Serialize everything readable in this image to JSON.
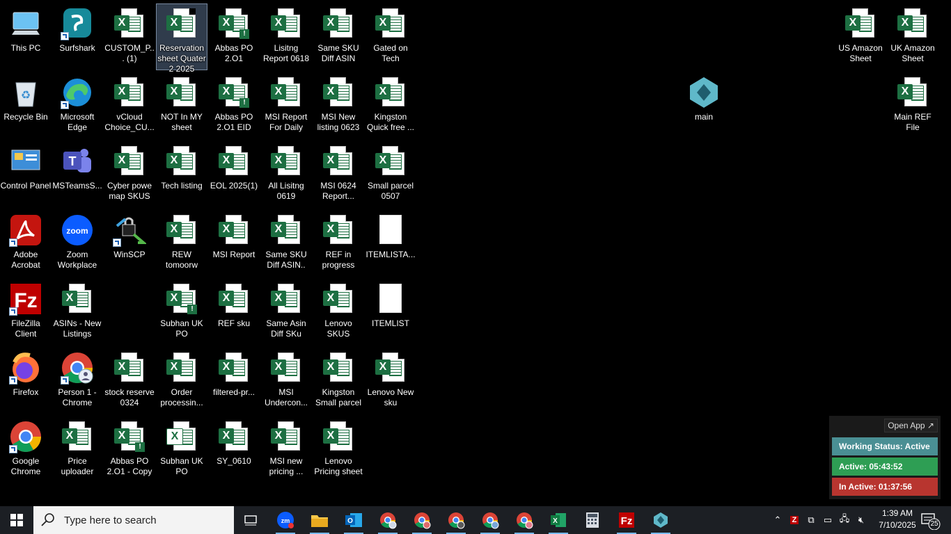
{
  "desktop": {
    "selected": "Reservation sheet Quater 2 2025",
    "icons": [
      {
        "label": "This PC",
        "type": "pc"
      },
      {
        "label": "Surfshark",
        "type": "surfshark"
      },
      {
        "label": "CUSTOM_P... (1)",
        "type": "excel"
      },
      {
        "label": "Reservation sheet Quater 2 2025",
        "type": "excel"
      },
      {
        "label": "Abbas PO 2.O1",
        "type": "excel-alert"
      },
      {
        "label": "Lisitng Report 0618",
        "type": "excel"
      },
      {
        "label": "Same SKU Diff ASIN",
        "type": "excel"
      },
      {
        "label": "Gated on Tech",
        "type": "excel"
      },
      {
        "label": "US Amazon Sheet",
        "type": "excel"
      },
      {
        "label": "UK Amazon Sheet",
        "type": "excel"
      },
      {
        "label": "Recycle Bin",
        "type": "recycle"
      },
      {
        "label": "Microsoft Edge",
        "type": "edge"
      },
      {
        "label": "vCloud Choice_CU...",
        "type": "excel"
      },
      {
        "label": "NOT In MY sheet",
        "type": "excel"
      },
      {
        "label": "Abbas PO 2.O1  EID",
        "type": "excel-alert"
      },
      {
        "label": "MSI Report For Daily",
        "type": "excel"
      },
      {
        "label": "MSI New listing 0623",
        "type": "excel"
      },
      {
        "label": "Kingston Quick free ...",
        "type": "excel"
      },
      {
        "label": "main",
        "type": "main"
      },
      {
        "label": "Main REF File",
        "type": "excel"
      },
      {
        "label": "Control Panel",
        "type": "control"
      },
      {
        "label": "MSTeamsS...",
        "type": "teams"
      },
      {
        "label": "Cyber powe map SKUS",
        "type": "excel"
      },
      {
        "label": "Tech listing",
        "type": "excel"
      },
      {
        "label": "EOL 2025(1)",
        "type": "excel"
      },
      {
        "label": "All Lisitng 0619",
        "type": "excel"
      },
      {
        "label": "MSI 0624 Report...",
        "type": "excel"
      },
      {
        "label": "Small parcel 0507",
        "type": "excel"
      },
      {
        "label": "Adobe Acrobat",
        "type": "acrobat"
      },
      {
        "label": "Zoom Workplace",
        "type": "zoom"
      },
      {
        "label": "WinSCP",
        "type": "winscp"
      },
      {
        "label": "REW tomoorw",
        "type": "excel"
      },
      {
        "label": "MSI Report",
        "type": "excel"
      },
      {
        "label": "Same SKU Diff ASIN..",
        "type": "excel"
      },
      {
        "label": "REF in progress",
        "type": "excel"
      },
      {
        "label": "ITEMLISTA...",
        "type": "blank"
      },
      {
        "label": "FileZilla Client",
        "type": "filezilla"
      },
      {
        "label": "ASINs - New Listings",
        "type": "excel"
      },
      {
        "label": "Subhan UK PO",
        "type": "excel-alert"
      },
      {
        "label": "REF sku",
        "type": "excel"
      },
      {
        "label": "Same Asin Diff SKu",
        "type": "excel"
      },
      {
        "label": "Lenovo SKUS",
        "type": "excel"
      },
      {
        "label": "ITEMLIST",
        "type": "blank"
      },
      {
        "label": "Firefox",
        "type": "firefox"
      },
      {
        "label": "Person 1 - Chrome",
        "type": "chrome-person"
      },
      {
        "label": "stock reserve 0324",
        "type": "excel"
      },
      {
        "label": "Order processin...",
        "type": "excel"
      },
      {
        "label": "filtered-pr...",
        "type": "excel"
      },
      {
        "label": "MSI Undercon...",
        "type": "excel"
      },
      {
        "label": "Kingston Small parcel",
        "type": "excel"
      },
      {
        "label": "Lenovo New sku",
        "type": "excel"
      },
      {
        "label": "Google Chrome",
        "type": "chrome"
      },
      {
        "label": "Price uploader",
        "type": "excel"
      },
      {
        "label": "Abbas PO 2.O1 - Copy",
        "type": "excel-alert"
      },
      {
        "label": "Subhan UK PO",
        "type": "excel-outline"
      },
      {
        "label": "SY_0610",
        "type": "excel"
      },
      {
        "label": "MSI new pricing ...",
        "type": "excel"
      },
      {
        "label": "Lenovo Pricing sheet",
        "type": "excel"
      }
    ]
  },
  "widget": {
    "open_app": "Open App ↗",
    "status": "Working Status: Active",
    "active": "Active: 05:43:52",
    "inactive": "In Active: 01:37:56",
    "colors": {
      "status": "#4a8f94",
      "active": "#2e9e54",
      "inactive": "#b8352f"
    }
  },
  "taskbar": {
    "search_placeholder": "Type here to search",
    "apps": [
      "task-view",
      "zoom",
      "file-explorer",
      "outlook",
      "chrome-profile-1",
      "chrome-profile-2",
      "chrome-profile-3",
      "chrome-profile-4",
      "chrome-profile-5",
      "excel",
      "calculator",
      "filezilla",
      "main-app"
    ],
    "clock_time": "1:39 AM",
    "clock_date": "7/10/2025",
    "notification_count": "25",
    "accent": "#76b9ed"
  }
}
